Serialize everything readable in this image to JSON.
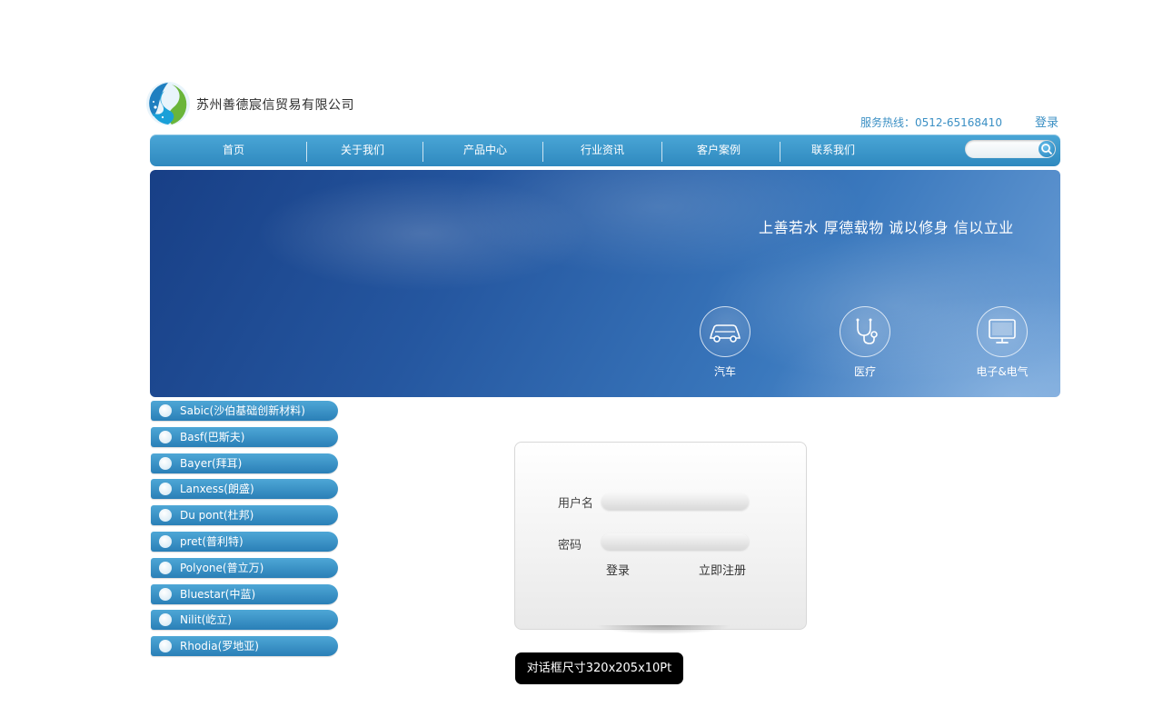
{
  "header": {
    "company_name": "苏州善德宸信贸易有限公司",
    "hotline": "服务热线：0512-65168410",
    "login_link": "登录"
  },
  "nav": {
    "items": [
      {
        "label": "首页"
      },
      {
        "label": "关于我们"
      },
      {
        "label": "产品中心"
      },
      {
        "label": "行业资讯"
      },
      {
        "label": "客户案例"
      },
      {
        "label": "联系我们"
      }
    ],
    "search": {
      "placeholder": ""
    }
  },
  "banner": {
    "slogan": "上善若水 厚德载物 诚以修身 信以立业",
    "industries": [
      {
        "label": "汽车",
        "icon": "car-icon"
      },
      {
        "label": "医疗",
        "icon": "stethoscope-icon"
      },
      {
        "label": "电子&电气",
        "icon": "monitor-icon"
      }
    ]
  },
  "brands": [
    {
      "label": "Sabic(沙伯基础创新材料)"
    },
    {
      "label": "Basf(巴斯夫)"
    },
    {
      "label": "Bayer(拜耳)"
    },
    {
      "label": "Lanxess(朗盛)"
    },
    {
      "label": "Du pont(杜邦)"
    },
    {
      "label": "pret(普利特)"
    },
    {
      "label": "Polyone(普立万)"
    },
    {
      "label": "Bluestar(中蓝)"
    },
    {
      "label": "Nilit(屹立)"
    },
    {
      "label": "Rhodia(罗地亚)"
    }
  ],
  "login": {
    "username_label": "用户名",
    "password_label": "密码",
    "username_value": "",
    "password_value": "",
    "login_button": "登录",
    "register_link": "立即注册"
  },
  "annotation": {
    "size_note": "对话框尺寸320x205x10Pt"
  },
  "colors": {
    "nav_blue": "#3a95c9",
    "accent_text": "#3a8fc4",
    "logo_green": "#6ab53a"
  }
}
